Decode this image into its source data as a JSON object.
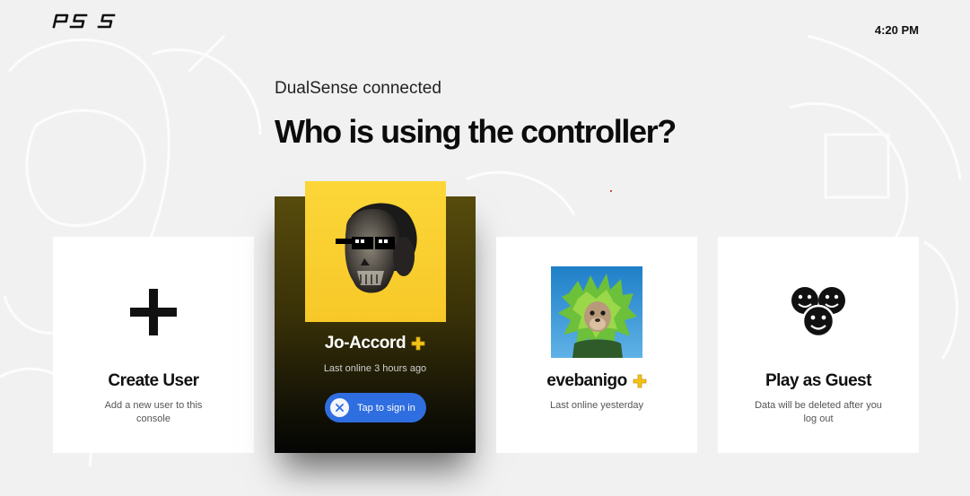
{
  "header": {
    "clock": "4:20 PM"
  },
  "prompt": {
    "subtitle": "DualSense connected",
    "headline": "Who is using the controller?"
  },
  "cards": {
    "create_user": {
      "title": "Create User",
      "description": "Add a new user to this console",
      "icon": "plus-icon"
    },
    "jo_accord": {
      "name": "Jo-Accord",
      "status": "Last online 3 hours ago",
      "signin_label": "Tap to sign in",
      "badge_icon": "ps-plus-icon",
      "selected": true
    },
    "evebanigo": {
      "name": "evebanigo",
      "status": "Last online yesterday",
      "badge_icon": "ps-plus-icon"
    },
    "guest": {
      "title": "Play as Guest",
      "description": "Data will be deleted after you log out",
      "icon": "guest-faces-icon"
    }
  },
  "colors": {
    "background": "#f1f1f1",
    "selected_card_top": "#574b0c",
    "selected_card_bottom": "#050505",
    "avatar_yellow": "#fcd638",
    "signin_blue": "#2f6ee0",
    "ps_plus_gold": "#f3c417"
  }
}
